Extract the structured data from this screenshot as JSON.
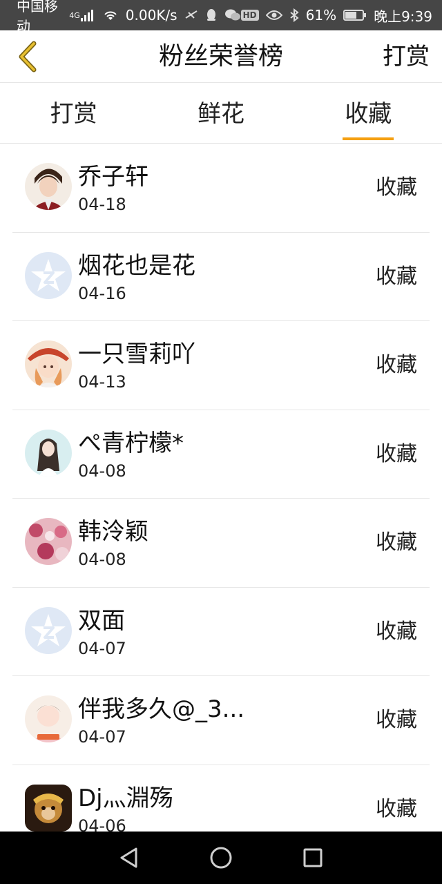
{
  "status_bar": {
    "carrier": "中国移动",
    "network": "4G",
    "speed": "0.00K/s",
    "battery": "61%",
    "time": "晚上9:39",
    "hd_label": "HD"
  },
  "header": {
    "title": "粉丝荣誉榜",
    "right_action": "打赏",
    "back_icon": "chevron-left-icon"
  },
  "tabs": [
    {
      "label": "打赏",
      "active": false
    },
    {
      "label": "鲜花",
      "active": false
    },
    {
      "label": "收藏",
      "active": true
    }
  ],
  "list": [
    {
      "name": "乔子轩",
      "date": "04-18",
      "action": "收藏",
      "avatar": "anime-boy"
    },
    {
      "name": "烟花也是花",
      "date": "04-16",
      "action": "收藏",
      "avatar": "default-star"
    },
    {
      "name": "一只雪莉吖",
      "date": "04-13",
      "action": "收藏",
      "avatar": "anime-girl"
    },
    {
      "name": "ぺ青柠檬*",
      "date": "04-08",
      "action": "收藏",
      "avatar": "photo-girl"
    },
    {
      "name": "韩泠颖",
      "date": "04-08",
      "action": "收藏",
      "avatar": "flowers"
    },
    {
      "name": "双面",
      "date": "04-07",
      "action": "收藏",
      "avatar": "default-star"
    },
    {
      "name": "伴我多久@_3...",
      "date": "04-07",
      "action": "收藏",
      "avatar": "photo-child"
    },
    {
      "name": "Dj灬淵殇",
      "date": "04-06",
      "action": "收藏",
      "avatar": "monkey-king"
    }
  ],
  "colors": {
    "accent": "#f5a012",
    "status_bar_bg": "#464646",
    "nav_bar_bg": "#000000",
    "default_avatar_bg": "#dfe8f5"
  },
  "navbar": {
    "back": "triangle-back-icon",
    "home": "circle-home-icon",
    "recents": "square-recents-icon"
  }
}
